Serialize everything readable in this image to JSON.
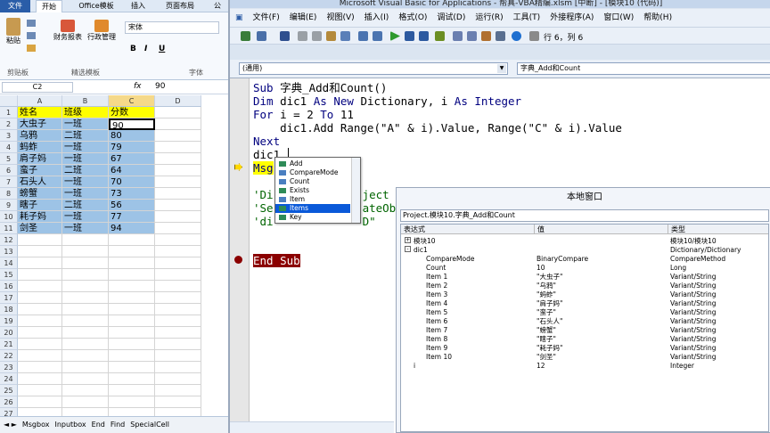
{
  "excel": {
    "tabs": [
      {
        "label": "文件"
      },
      {
        "label": "开始"
      },
      {
        "label": "Office模板"
      },
      {
        "label": "插入"
      },
      {
        "label": "页面布局"
      },
      {
        "label": "公"
      }
    ],
    "ribbon": {
      "paste": "粘贴",
      "clipboard_group": "剪贴板",
      "finance_report": "财务报表",
      "admin": "行政管理",
      "template_group": "精选模板",
      "font_name": "宋体",
      "font_group": "字体",
      "bold": "B",
      "italic": "I",
      "underline": "U"
    },
    "name_box": "C2",
    "fx_symbol": "fx",
    "formula_value": "90",
    "columns": [
      "A",
      "B",
      "C",
      "D"
    ],
    "rows": [
      "1",
      "2",
      "3",
      "4",
      "5",
      "6",
      "7",
      "8",
      "9",
      "10",
      "11",
      "12",
      "13",
      "14",
      "15",
      "16",
      "17",
      "18",
      "19",
      "20",
      "21",
      "22",
      "23",
      "24",
      "25",
      "26",
      "27"
    ],
    "table": [
      [
        "姓名",
        "班级",
        "分数"
      ],
      [
        "大虫子",
        "一班",
        "90"
      ],
      [
        "乌鸦",
        "二班",
        "80"
      ],
      [
        "蚂蚱",
        "一班",
        "79"
      ],
      [
        "肩子妈",
        "一班",
        "67"
      ],
      [
        "蛮子",
        "二班",
        "64"
      ],
      [
        "石头人",
        "一班",
        "70"
      ],
      [
        "螃蟹",
        "一班",
        "73"
      ],
      [
        "瞎子",
        "二班",
        "56"
      ],
      [
        "耗子妈",
        "一班",
        "77"
      ],
      [
        "剑圣",
        "一班",
        "94"
      ]
    ],
    "sheet_tabs": [
      "Msgbox",
      "Inputbox",
      "End",
      "Find",
      "SpecialCell"
    ]
  },
  "vbe": {
    "title": "Microsoft Visual Basic for Applications - 帮真-VBA精编.xlsm [中断] - [模块10 (代码)]",
    "menu": [
      "文件(F)",
      "编辑(E)",
      "视图(V)",
      "插入(I)",
      "格式(O)",
      "调试(D)",
      "运行(R)",
      "工具(T)",
      "外接程序(A)",
      "窗口(W)",
      "帮助(H)"
    ],
    "position": "行 6，列 6",
    "object_combo": "(通用)",
    "proc_combo": "字典_Add和Count",
    "code": {
      "line1_kw": "Sub ",
      "line1_rest": "字典_Add和Count()",
      "line2_kw": "Dim ",
      "line2_a": "dic1 ",
      "line2_kw2": "As New ",
      "line2_b": "Dictionary, i ",
      "line2_kw3": "As ",
      "line2_c": "Integer",
      "line3_kw": "For ",
      "line3_a": "i = 2 ",
      "line3_kw2": "To ",
      "line3_b": "11",
      "line4": "    dic1.Add Range(\"A\" & i).Value, Range(\"C\" & i).Value",
      "line5_kw": "Next",
      "line6": "dic1.",
      "line7_a": "Msg",
      "line7_b": "nt",
      "line8": "'Di",
      "line8b": "ject",
      "line9": "'Se",
      "line9b": "ateOb",
      "line10": "'di",
      "line10b": "D\"",
      "end_sub": "End Sub"
    },
    "autocomplete": [
      {
        "label": "Add",
        "selected": false
      },
      {
        "label": "CompareMode",
        "selected": false
      },
      {
        "label": "Count",
        "selected": false
      },
      {
        "label": "Exists",
        "selected": false
      },
      {
        "label": "Item",
        "selected": false
      },
      {
        "label": "Items",
        "selected": true
      },
      {
        "label": "Key",
        "selected": false
      }
    ],
    "locals": {
      "title": "本地窗口",
      "context": "Project.模块10.字典_Add和Count",
      "headers": [
        "表达式",
        "值",
        "类型"
      ],
      "rows": [
        {
          "expr": "模块10",
          "value": "",
          "type": "模块10/模块10",
          "indent": 0,
          "expander": "+"
        },
        {
          "expr": "dic1",
          "value": "",
          "type": "Dictionary/Dictionary",
          "indent": 0,
          "expander": "-"
        },
        {
          "expr": "CompareMode",
          "value": "BinaryCompare",
          "type": "CompareMethod",
          "indent": 1,
          "expander": ""
        },
        {
          "expr": "Count",
          "value": "10",
          "type": "Long",
          "indent": 1,
          "expander": ""
        },
        {
          "expr": "Item 1",
          "value": "\"大虫子\"",
          "type": "Variant/String",
          "indent": 1,
          "expander": ""
        },
        {
          "expr": "Item 2",
          "value": "\"乌鸦\"",
          "type": "Variant/String",
          "indent": 1,
          "expander": ""
        },
        {
          "expr": "Item 3",
          "value": "\"蚂蚱\"",
          "type": "Variant/String",
          "indent": 1,
          "expander": ""
        },
        {
          "expr": "Item 4",
          "value": "\"肩子妈\"",
          "type": "Variant/String",
          "indent": 1,
          "expander": ""
        },
        {
          "expr": "Item 5",
          "value": "\"蛮子\"",
          "type": "Variant/String",
          "indent": 1,
          "expander": ""
        },
        {
          "expr": "Item 6",
          "value": "\"石头人\"",
          "type": "Variant/String",
          "indent": 1,
          "expander": ""
        },
        {
          "expr": "Item 7",
          "value": "\"螃蟹\"",
          "type": "Variant/String",
          "indent": 1,
          "expander": ""
        },
        {
          "expr": "Item 8",
          "value": "\"瞎子\"",
          "type": "Variant/String",
          "indent": 1,
          "expander": ""
        },
        {
          "expr": "Item 9",
          "value": "\"耗子妈\"",
          "type": "Variant/String",
          "indent": 1,
          "expander": ""
        },
        {
          "expr": "Item 10",
          "value": "\"剑圣\"",
          "type": "Variant/String",
          "indent": 1,
          "expander": ""
        },
        {
          "expr": "i",
          "value": "12",
          "type": "Integer",
          "indent": 0,
          "expander": ""
        }
      ]
    }
  },
  "colors": {
    "header_fill": "#ffff00",
    "data_fill": "#9dc3e6",
    "keyword": "#00007f",
    "comment": "#006400",
    "breakpoint": "#8b0000",
    "selection": "#0a59d9"
  },
  "icons": [
    "paste-icon",
    "finance-report-icon",
    "admin-icon",
    "save-icon",
    "run-icon",
    "pause-icon",
    "stop-icon",
    "breakpoint-icon",
    "exec-arrow-icon"
  ]
}
